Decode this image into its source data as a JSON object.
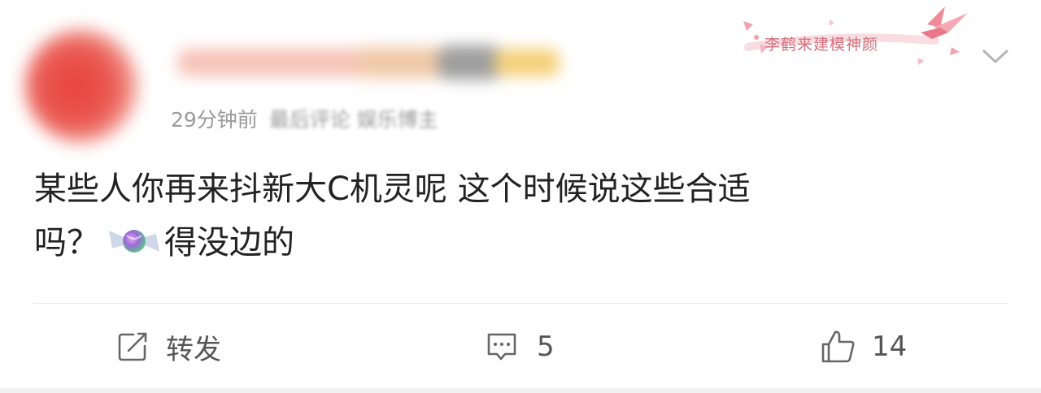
{
  "post": {
    "avatar_color": "#e8413f",
    "meta": {
      "time": "29分钟前",
      "obscured_text": "最后评论 娱乐博主"
    },
    "badge": {
      "text": "李鹤来建模神颜",
      "color": "#d4707d"
    },
    "content": {
      "line1": "某些人你再来抖新大C机灵呢 这个时候说这些合适",
      "line2_prefix": "吗？",
      "emoji": "candy-icon",
      "line2_suffix": "得没边的"
    }
  },
  "actions": {
    "repost_label": "转发",
    "comment_count": "5",
    "like_count": "14"
  },
  "colors": {
    "text": "#222222",
    "meta": "#9a9a9a",
    "action": "#555555",
    "divider": "#e8e8e8"
  }
}
